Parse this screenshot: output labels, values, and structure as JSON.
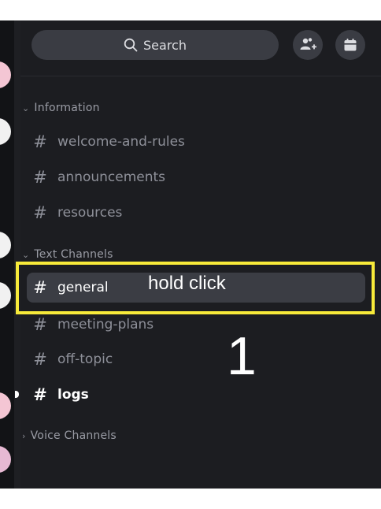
{
  "search": {
    "label": "Search"
  },
  "categories": {
    "information": "Information",
    "text_channels": "Text Channels",
    "voice_channels": "Voice Channels"
  },
  "channels": {
    "information": [
      "welcome-and-rules",
      "announcements",
      "resources"
    ],
    "text": [
      "general",
      "meeting-plans",
      "off-topic",
      "logs"
    ]
  },
  "hash_symbol": "#",
  "annotation": {
    "instruction": "hold click",
    "step_number": "1"
  },
  "colors": {
    "highlight": "#f7ea3a",
    "background": "#1c1d21",
    "selected": "#3b3d44"
  }
}
